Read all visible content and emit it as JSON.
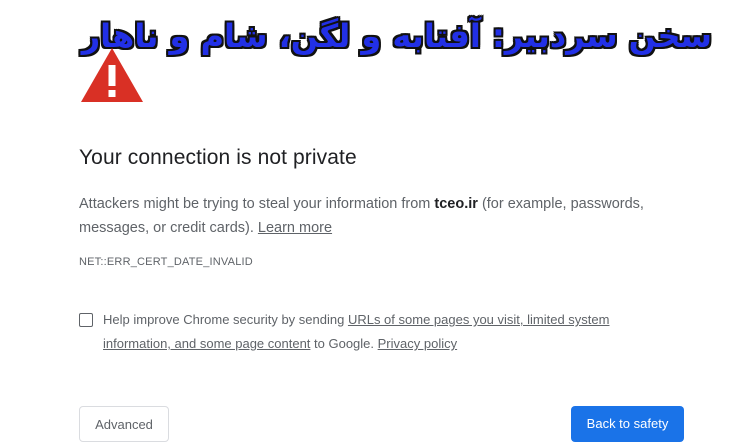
{
  "banner": {
    "headline": "سخن سردبیر: آفتابه و لگن، شام و ناهار",
    "color": "#2230e6"
  },
  "error_page": {
    "icon": "warning-triangle-icon",
    "icon_color": "#d93025",
    "title": "Your connection is not private",
    "desc_prefix": "Attackers might be trying to steal your information from ",
    "domain": "tceo.ir",
    "desc_suffix": " (for example, passwords, messages, or credit cards). ",
    "learn_more": "Learn more",
    "error_code": "NET::ERR_CERT_DATE_INVALID",
    "help": {
      "prefix": "Help improve Chrome security by sending ",
      "link1": "URLs of some pages you visit, limited system information, and some page content",
      "middle": " to Google. ",
      "link2": "Privacy policy",
      "checked": false
    },
    "buttons": {
      "advanced": "Advanced",
      "back_to_safety": "Back to safety"
    },
    "accent": "#1a73e8"
  }
}
